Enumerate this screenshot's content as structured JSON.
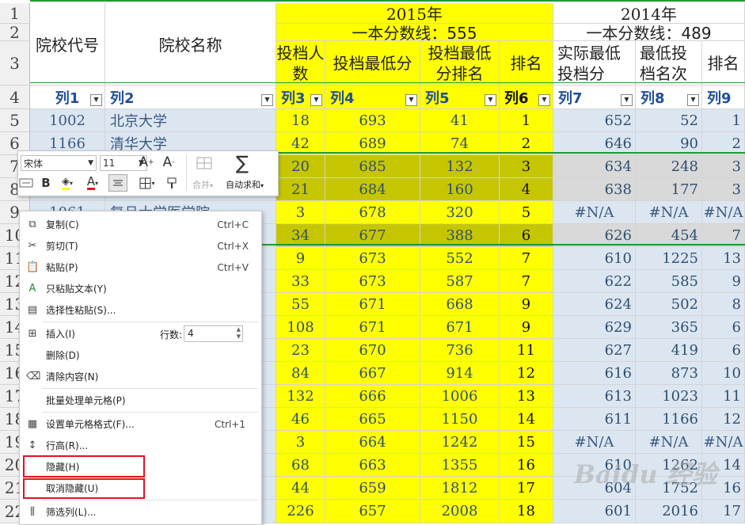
{
  "row_numbers": [
    "1",
    "2",
    "3",
    "4",
    "5",
    "6",
    "7",
    "8",
    "9",
    "10",
    "11",
    "12",
    "13",
    "14",
    "15",
    "16",
    "17",
    "18",
    "19",
    "20",
    "21",
    "22"
  ],
  "header": {
    "code": "院校代号",
    "name": "院校名称",
    "year_2015": "2015年",
    "year_2014": "2014年",
    "line_2015": "一本分数线：555",
    "line_2014": "一本分数线：489",
    "c3": "投档人数",
    "c4": "投档最低分",
    "c5": "投档最低分排名",
    "c6": "排名",
    "c7": "实际最低投档分",
    "c8": "最低投档名次",
    "c9": "排名"
  },
  "col_labels": [
    "列1",
    "列2",
    "列3",
    "列4",
    "列5",
    "列6",
    "列7",
    "列8",
    "列9"
  ],
  "rows": [
    {
      "code": "1002",
      "name": "北京大学",
      "c3": "18",
      "c4": "693",
      "c5": "41",
      "c6": "1",
      "c7": "652",
      "c8": "52",
      "c9": "1"
    },
    {
      "code": "1166",
      "name": "清华大学",
      "c3": "42",
      "c4": "689",
      "c5": "74",
      "c6": "2",
      "c7": "646",
      "c8": "90",
      "c9": "2"
    },
    {
      "code": "",
      "name": "",
      "c3": "20",
      "c4": "685",
      "c5": "132",
      "c6": "3",
      "c7": "634",
      "c8": "248",
      "c9": "3"
    },
    {
      "code": "",
      "name": "",
      "c3": "21",
      "c4": "684",
      "c5": "160",
      "c6": "4",
      "c7": "638",
      "c8": "177",
      "c9": "3"
    },
    {
      "code": "1061",
      "name": "复旦大学医学院",
      "c3": "3",
      "c4": "678",
      "c5": "320",
      "c6": "5",
      "c7": "#N/A",
      "c8": "#N/A",
      "c9": "#N/A"
    },
    {
      "code": "",
      "name": "",
      "c3": "34",
      "c4": "677",
      "c5": "388",
      "c6": "6",
      "c7": "626",
      "c8": "454",
      "c9": "7"
    },
    {
      "code": "",
      "name": "",
      "c3": "9",
      "c4": "673",
      "c5": "552",
      "c6": "7",
      "c7": "610",
      "c8": "1225",
      "c9": "13"
    },
    {
      "code": "",
      "name": "",
      "c3": "33",
      "c4": "673",
      "c5": "587",
      "c6": "7",
      "c7": "622",
      "c8": "585",
      "c9": "9"
    },
    {
      "code": "",
      "name": "",
      "c3": "55",
      "c4": "671",
      "c5": "668",
      "c6": "9",
      "c7": "624",
      "c8": "502",
      "c9": "8"
    },
    {
      "code": "",
      "name": "",
      "c3": "108",
      "c4": "671",
      "c5": "671",
      "c6": "9",
      "c7": "629",
      "c8": "365",
      "c9": "6"
    },
    {
      "code": "",
      "name": "",
      "c3": "23",
      "c4": "670",
      "c5": "736",
      "c6": "11",
      "c7": "627",
      "c8": "419",
      "c9": "6"
    },
    {
      "code": "",
      "name": "",
      "c3": "84",
      "c4": "667",
      "c5": "914",
      "c6": "12",
      "c7": "616",
      "c8": "873",
      "c9": "10"
    },
    {
      "code": "",
      "name": "",
      "c3": "132",
      "c4": "666",
      "c5": "1006",
      "c6": "13",
      "c7": "613",
      "c8": "1023",
      "c9": "11"
    },
    {
      "code": "",
      "name": "",
      "c3": "46",
      "c4": "665",
      "c5": "1150",
      "c6": "14",
      "c7": "611",
      "c8": "1166",
      "c9": "12"
    },
    {
      "code": "",
      "name": "",
      "c3": "3",
      "c4": "664",
      "c5": "1242",
      "c6": "15",
      "c7": "#N/A",
      "c8": "#N/A",
      "c9": "#N/A"
    },
    {
      "code": "",
      "name": "",
      "c3": "68",
      "c4": "663",
      "c5": "1355",
      "c6": "16",
      "c7": "610",
      "c8": "1262",
      "c9": "14"
    },
    {
      "code": "",
      "name": "",
      "c3": "44",
      "c4": "659",
      "c5": "1812",
      "c6": "17",
      "c7": "604",
      "c8": "1752",
      "c9": "16"
    },
    {
      "code": "",
      "name": "",
      "c3": "226",
      "c4": "657",
      "c5": "2008",
      "c6": "18",
      "c7": "601",
      "c8": "2016",
      "c9": "17"
    }
  ],
  "toolbar": {
    "font_name": "宋体",
    "font_size": "11",
    "grow": "A⁺",
    "shrink": "A⁻",
    "bold": "B",
    "merge": "合并",
    "autosum": "自动求和"
  },
  "menu": {
    "copy": "复制(C)",
    "copy_sc": "Ctrl+C",
    "cut": "剪切(T)",
    "cut_sc": "Ctrl+X",
    "paste": "粘贴(P)",
    "paste_sc": "Ctrl+V",
    "paste_text": "只粘贴文本(Y)",
    "paste_special": "选择性粘贴(S)...",
    "insert": "插入(I)",
    "row_count_label": "行数:",
    "row_count_value": "4",
    "delete": "删除(D)",
    "clear": "清除内容(N)",
    "batch": "批量处理单元格(P)",
    "format": "设置单元格格式(F)...",
    "format_sc": "Ctrl+1",
    "row_height": "行高(R)...",
    "hide": "隐藏(H)",
    "unhide": "取消隐藏(U)",
    "filter_col": "筛选列(L)..."
  },
  "watermark": "Baidu 经验"
}
